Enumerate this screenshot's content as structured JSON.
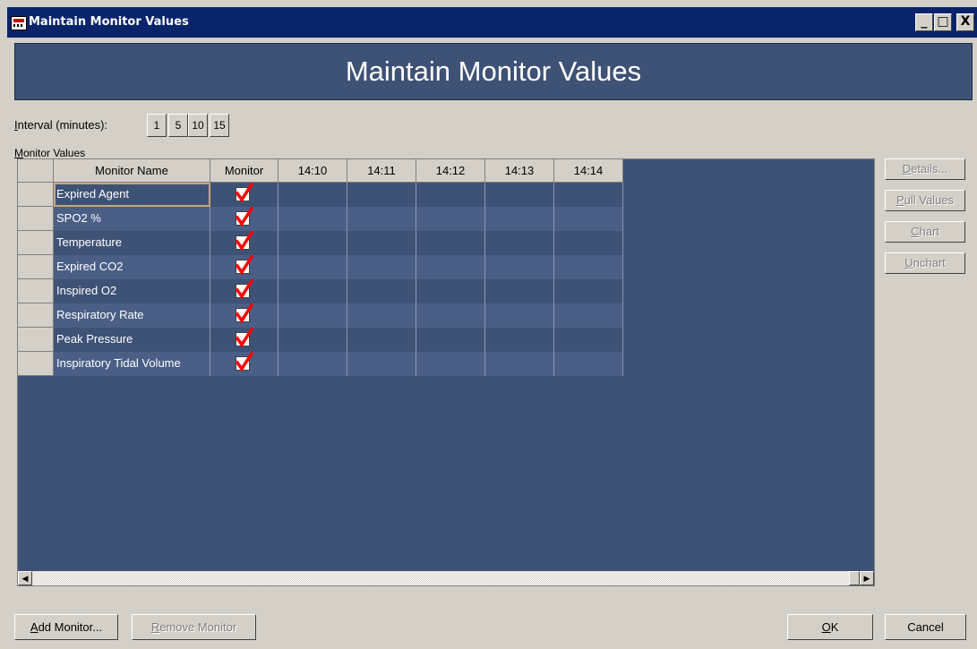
{
  "window": {
    "title": "Maintain Monitor Values",
    "controls": {
      "minimize": "_",
      "maximize": "□",
      "close": "X"
    }
  },
  "banner": {
    "title": "Maintain Monitor Values"
  },
  "interval": {
    "label_ul": "I",
    "label_rest": "nterval (minutes):",
    "options": [
      "1",
      "5",
      "10",
      "15"
    ]
  },
  "monitor_values": {
    "label_ul": "M",
    "label_rest": "onitor Values",
    "columns": [
      "Monitor Name",
      "Monitor",
      "14:10",
      "14:11",
      "14:12",
      "14:13",
      "14:14"
    ],
    "rows": [
      {
        "name": "Expired Agent",
        "monitor": true
      },
      {
        "name": "SPO2 %",
        "monitor": true
      },
      {
        "name": "Temperature",
        "monitor": true
      },
      {
        "name": "Expired CO2",
        "monitor": true
      },
      {
        "name": "Inspired O2",
        "monitor": true
      },
      {
        "name": "Respiratory Rate",
        "monitor": true
      },
      {
        "name": "Peak Pressure",
        "monitor": true
      },
      {
        "name": "Inspiratory Tidal Volume",
        "monitor": true
      }
    ]
  },
  "side_buttons": {
    "details": {
      "ul": "D",
      "rest": "etails..."
    },
    "pull_values": {
      "ul": "P",
      "rest": "ull Values"
    },
    "chart": {
      "ul": "C",
      "rest": "hart"
    },
    "unchart": {
      "ul": "U",
      "rest": "nchart"
    }
  },
  "bottom_buttons": {
    "add_monitor": {
      "ul": "A",
      "rest": "dd Monitor..."
    },
    "remove_monitor": {
      "ul": "R",
      "rest": "emove Monitor"
    },
    "ok": {
      "ul": "O",
      "rest": "K"
    },
    "cancel": {
      "label": "Cancel"
    }
  },
  "colors": {
    "titlebar": "#0a246a",
    "banner": "#3e5276",
    "grid_bg": "#3e5276",
    "check": "#ff0000"
  }
}
